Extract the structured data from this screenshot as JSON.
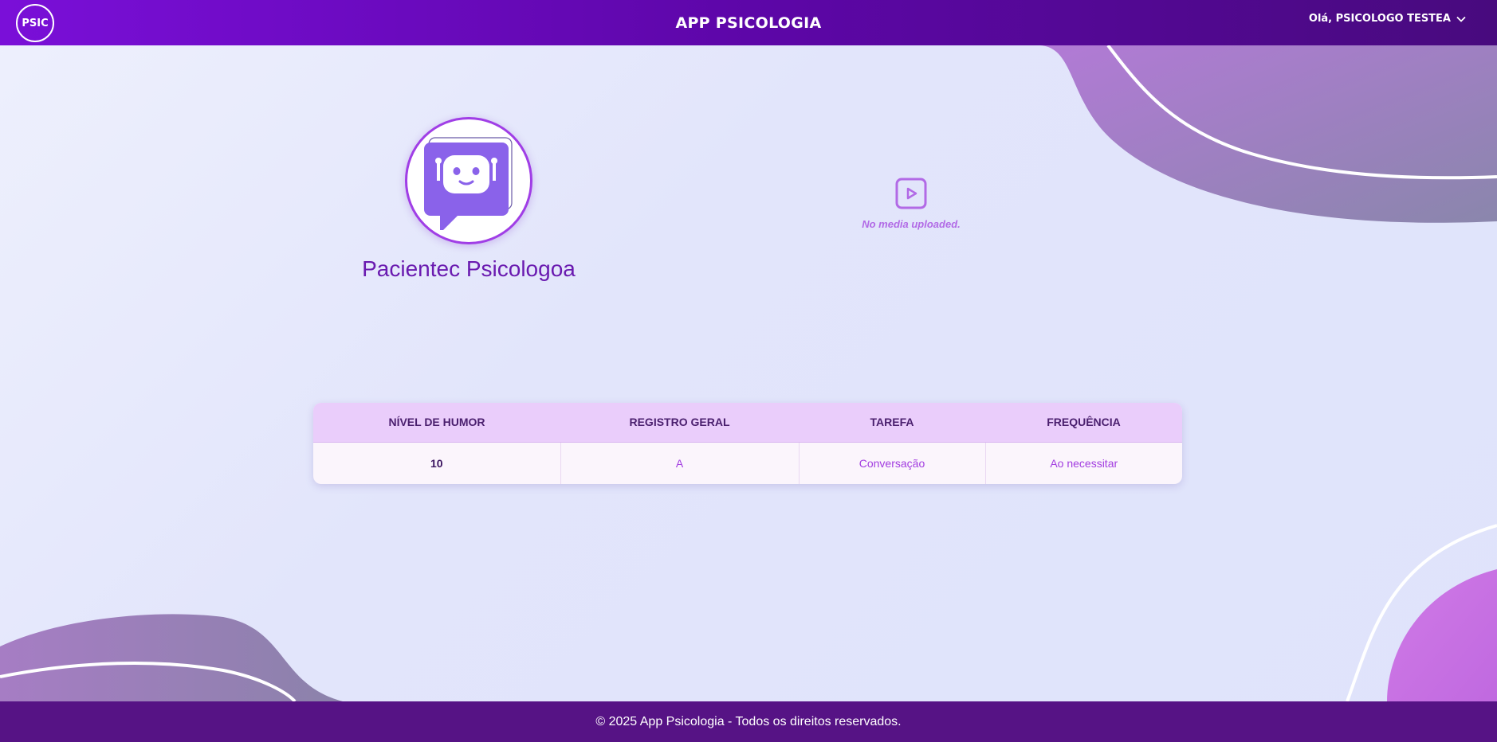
{
  "header": {
    "logo_text": "PSIC",
    "title": "APP PSICOLOGIA",
    "user_greeting": "Olá, PSICOLOGO TESTEA"
  },
  "profile": {
    "avatar_icon": "robot-chat-icon",
    "name": "Pacientec Psicologoa"
  },
  "media": {
    "icon": "play-icon",
    "empty_text": "No media uploaded."
  },
  "table": {
    "columns": [
      "NÍVEL DE HUMOR",
      "REGISTRO GERAL",
      "TAREFA",
      "FREQUÊNCIA"
    ],
    "rows": [
      [
        "10",
        "A",
        "Conversação",
        "Ao necessitar"
      ]
    ]
  },
  "footer": {
    "text": "© 2025 App Psicologia - Todos os direitos reservados."
  },
  "colors": {
    "header_start": "#7a0fd8",
    "header_end": "#480a7e",
    "accent": "#a03ee6",
    "footer": "#561385"
  }
}
